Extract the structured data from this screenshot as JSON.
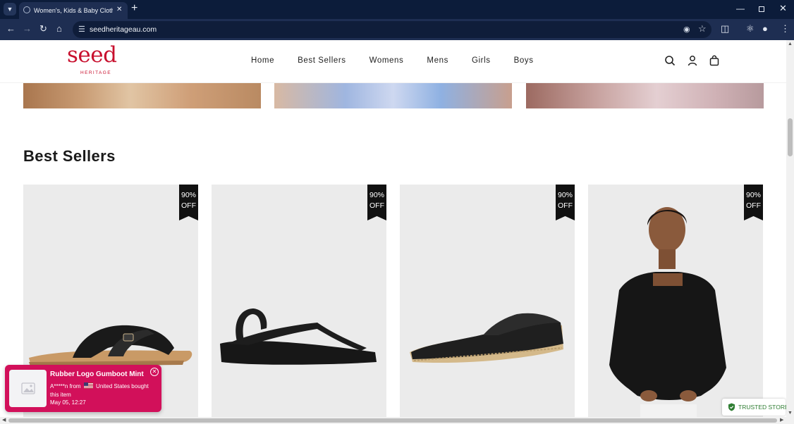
{
  "browser": {
    "tab_title": "Women's, Kids & Baby Clothing",
    "url": "seedheritageau.com",
    "colors": {
      "tabbar": "#0c1c3a",
      "toolbar": "#1e2e52"
    }
  },
  "site": {
    "logo": {
      "name": "seed",
      "subtitle": "HERITAGE",
      "color": "#c8102e"
    },
    "nav": [
      "Home",
      "Best Sellers",
      "Womens",
      "Mens",
      "Girls",
      "Boys"
    ],
    "header_icons": [
      "search-icon",
      "user-icon",
      "bag-icon"
    ]
  },
  "section": {
    "title": "Best Sellers"
  },
  "products": [
    {
      "badge_line1": "90%",
      "badge_line2": "OFF",
      "image": "black cross-strap slide sandal"
    },
    {
      "badge_line1": "90%",
      "badge_line2": "OFF",
      "image": "black toe-post flatform sandal"
    },
    {
      "badge_line1": "90%",
      "badge_line2": "OFF",
      "image": "black espadrille flat"
    },
    {
      "badge_line1": "90%",
      "badge_line2": "OFF",
      "image": "woman in black square-neck blouse"
    }
  ],
  "popup": {
    "title": "Rubber Logo Gumboot Mint",
    "buyer": "A*****n from",
    "location": "United States bought",
    "suffix": "this item",
    "time": "May 05, 12:27",
    "color": "#d2105a"
  },
  "trusted": {
    "label": "TRUSTED STORE",
    "color": "#2e7d32"
  }
}
